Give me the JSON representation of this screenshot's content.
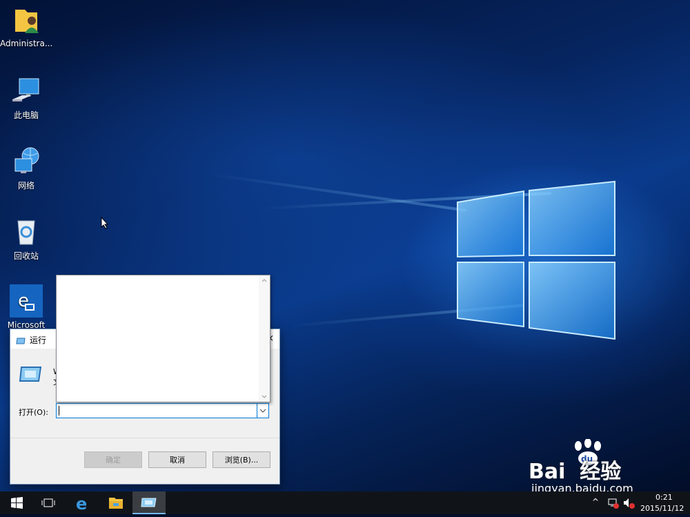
{
  "desktop": {
    "icons": [
      {
        "label": "Administra...",
        "icon": "user-folder-icon"
      },
      {
        "label": "此电脑",
        "icon": "this-pc-icon"
      },
      {
        "label": "网络",
        "icon": "network-icon"
      },
      {
        "label": "回收站",
        "icon": "recycle-bin-icon"
      },
      {
        "label": "Microsoft",
        "icon": "edge-icon"
      }
    ]
  },
  "run_dialog": {
    "title": "运行",
    "description_fragment": "W\n文",
    "open_label": "打开(O):",
    "input_value": "",
    "buttons": {
      "ok": "确定",
      "cancel": "取消",
      "browse": "浏览(B)..."
    }
  },
  "taskbar": {
    "items": [
      "start-icon",
      "task-view-icon",
      "edge-icon",
      "file-explorer-icon",
      "run-icon"
    ],
    "clock_time": "0:21",
    "clock_date": "2015/11/12"
  },
  "watermark": {
    "brand": "Bai  经验",
    "paw": "du",
    "url": "jingyan.baidu.com"
  },
  "colors": {
    "accent": "#0078d7",
    "taskbar": "#101419",
    "dialog": "#f0f0f0"
  }
}
